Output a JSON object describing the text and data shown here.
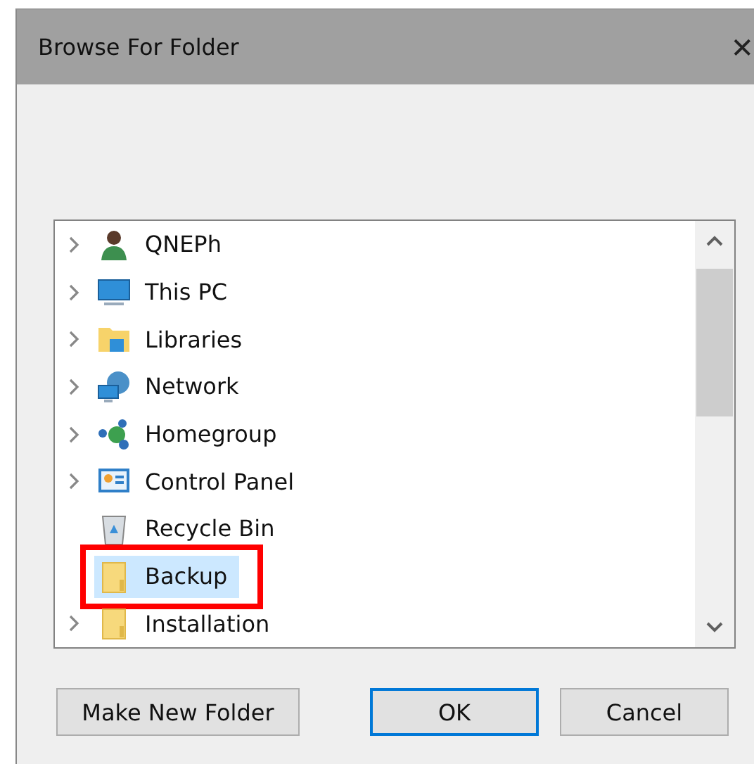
{
  "window": {
    "title": "Browse For Folder",
    "close": "✕"
  },
  "tree": {
    "items": [
      {
        "label": "QNEPh",
        "kind": "user",
        "expandable": true,
        "selected": false,
        "highlighted": false
      },
      {
        "label": "This PC",
        "kind": "pc",
        "expandable": true,
        "selected": false,
        "highlighted": false
      },
      {
        "label": "Libraries",
        "kind": "libraries",
        "expandable": true,
        "selected": false,
        "highlighted": false
      },
      {
        "label": "Network",
        "kind": "network",
        "expandable": true,
        "selected": false,
        "highlighted": false
      },
      {
        "label": "Homegroup",
        "kind": "homegroup",
        "expandable": true,
        "selected": false,
        "highlighted": false
      },
      {
        "label": "Control Panel",
        "kind": "control-panel",
        "expandable": true,
        "selected": false,
        "highlighted": false
      },
      {
        "label": "Recycle Bin",
        "kind": "recycle-bin",
        "expandable": false,
        "selected": false,
        "highlighted": false
      },
      {
        "label": "Backup",
        "kind": "folder",
        "expandable": false,
        "selected": true,
        "highlighted": true
      },
      {
        "label": "Installation",
        "kind": "folder",
        "expandable": true,
        "selected": false,
        "highlighted": false
      }
    ]
  },
  "buttons": [
    {
      "label": "Make New Folder",
      "default": false
    },
    {
      "label": "OK",
      "default": true
    },
    {
      "label": "Cancel",
      "default": false
    }
  ]
}
